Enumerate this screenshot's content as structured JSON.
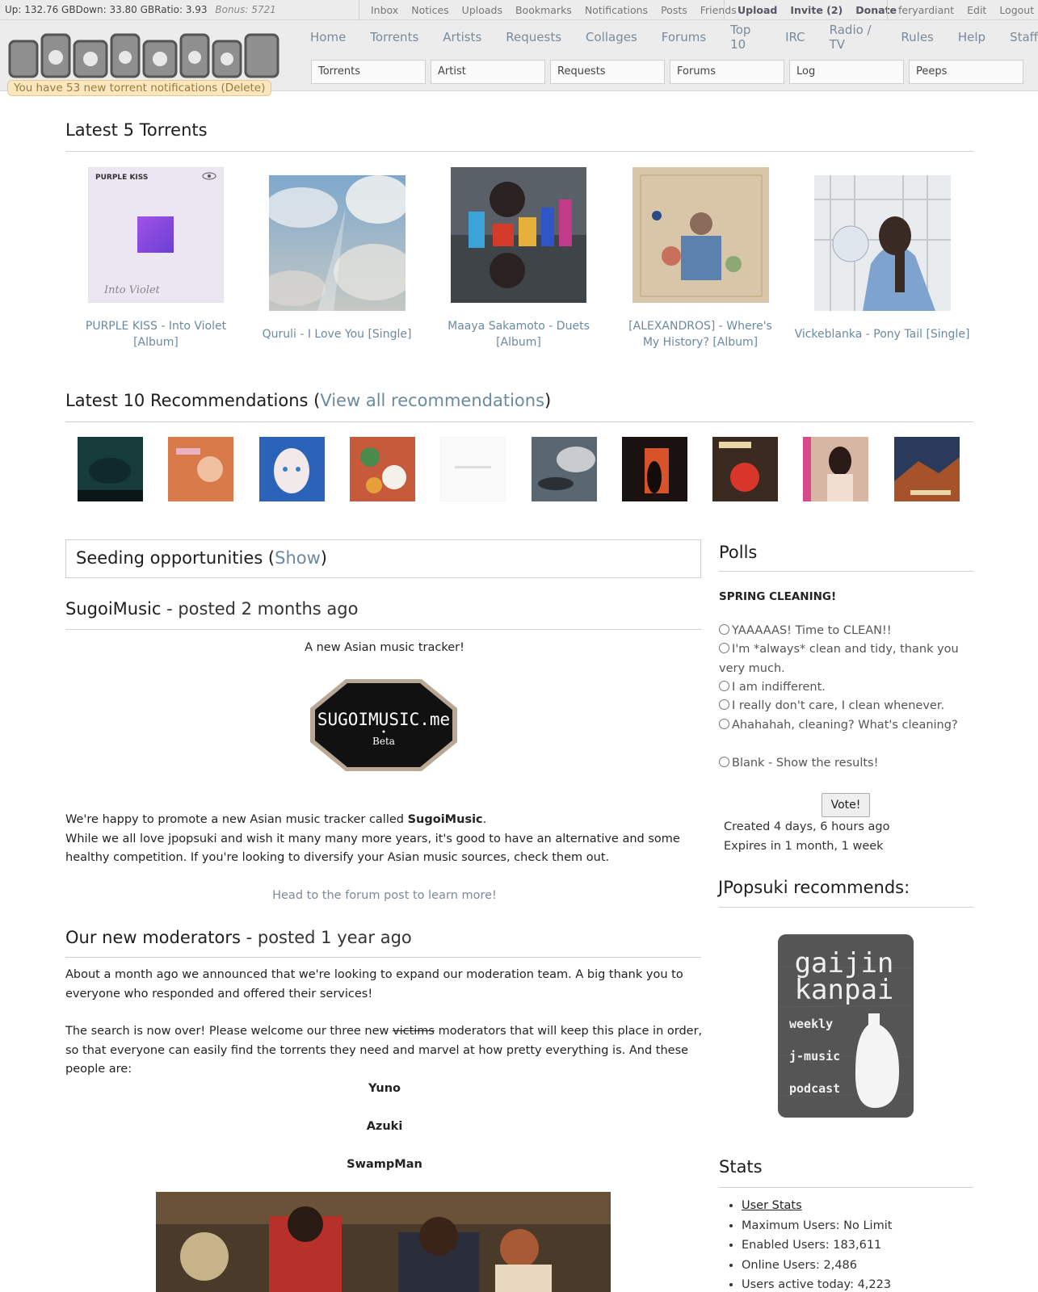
{
  "topbar": {
    "up": "Up: 132.76 GB",
    "down": "Down: 33.80 GB",
    "ratio": "Ratio: 3.93",
    "bonus": "Bonus: 5721",
    "links": [
      "Inbox",
      "Notices",
      "Uploads",
      "Bookmarks",
      "Notifications",
      "Posts",
      "Friends"
    ],
    "actions": [
      "Upload",
      "Invite (2)",
      "Donate"
    ],
    "user_links": [
      "feryardiant",
      "Edit",
      "Logout"
    ]
  },
  "header": {
    "logo_alt": "jpopsuki",
    "notification": "You have 53 new torrent notifications (Delete)",
    "nav": [
      "Home",
      "Torrents",
      "Artists",
      "Requests",
      "Collages",
      "Forums",
      "Top 10",
      "IRC",
      "Radio / TV",
      "Rules",
      "Help",
      "Staff"
    ],
    "search": [
      "Torrents",
      "Artist",
      "Requests",
      "Forums",
      "Log",
      "Peeps"
    ]
  },
  "latest": {
    "title": "Latest 5 Torrents",
    "items": [
      {
        "label": "PURPLE KISS - Into Violet [Album]",
        "cover_text": "PURPLE KISS",
        "sig": "Into Violet"
      },
      {
        "label": "Quruli - I Love You [Single]"
      },
      {
        "label": "Maaya Sakamoto - Duets [Album]"
      },
      {
        "label": "[ALEXANDROS] - Where's My History? [Album]"
      },
      {
        "label": "Vickeblanka - Pony Tail [Single]"
      }
    ]
  },
  "recs": {
    "title": "Latest 10 Recommendations (",
    "link": "View all recommendations",
    "close": ")",
    "colors": [
      "#173a3a",
      "#d97a4a",
      "#2a63b8",
      "#c65a3a",
      "#f4f4f4",
      "#5b6770",
      "#1a1210",
      "#3a2a20",
      "#d8b6a4",
      "#2a3a5a"
    ]
  },
  "seeding": {
    "text": "Seeding opportunities (",
    "link": "Show",
    "close": ")"
  },
  "news": [
    {
      "title": "SugoiMusic",
      "posted": " - posted 2 months ago",
      "tagline": "A new Asian music tracker!",
      "logo_text": "SUGOIMUSIC.me",
      "logo_sub": "Beta",
      "p1_a": "We're happy to promote a new Asian music tracker called ",
      "p1_b": "SugoiMusic",
      "p1_c": ".",
      "p2": "While we all love jpopsuki and wish it many many more years, it's good to have an alternative and some healthy competition. If you're looking to diversify your Asian music sources, check them out.",
      "link": "Head to the forum post to learn more!"
    },
    {
      "title": "Our new moderators",
      "posted": " - posted 1 year ago",
      "p1": "About a month ago we announced that we're looking to expand our moderation team. A big thank you to everyone who responded and offered their services!",
      "p2_a": "The search is now over! Please welcome our three new ",
      "p2_strike": "victims",
      "p2_b": " moderators that will keep this place in order, so that everyone can easily find the torrents they need and marvel at how pretty everything is. And these people are:",
      "mods": [
        "Yuno",
        "Azuki",
        "SwampMan"
      ]
    }
  ],
  "polls": {
    "title": "Polls",
    "question": "SPRING CLEANING!",
    "options": [
      "YAAAAAS! Time to CLEAN!!",
      "I'm *always* clean and tidy, thank you very much.",
      "I am indifferent.",
      "I really don't care, I clean whenever.",
      "Ahahahah, cleaning? What's cleaning?"
    ],
    "blank": "Blank - Show the results!",
    "vote": "Vote!",
    "created": "Created 4 days, 6 hours ago",
    "expires": "Expires in 1 month, 1 week"
  },
  "recommends": {
    "title": "JPopsuki recommends:",
    "lines": [
      "gaijin",
      "kanpai"
    ],
    "subs": [
      "weekly",
      "j-music",
      "podcast"
    ]
  },
  "stats": {
    "title": "Stats",
    "user_stats": "User Stats",
    "items": [
      "Maximum Users: No Limit",
      "Enabled Users: 183,611",
      "Online Users: 2,486",
      "Users active today: 4,223"
    ]
  }
}
